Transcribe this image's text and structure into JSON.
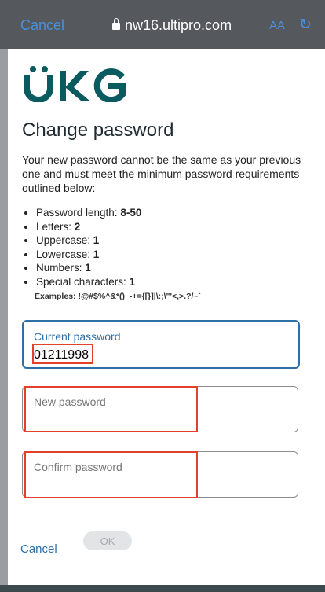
{
  "browser": {
    "cancel_label": "Cancel",
    "url": "nw16.ultipro.com",
    "text_size_label": "AA",
    "reload_icon": "↻"
  },
  "page": {
    "logo_text": "UKG",
    "title": "Change password",
    "intro": "Your new password cannot be the same as your previous one and must meet the minimum password requirements outlined below:",
    "requirements": [
      {
        "label": "Password length: ",
        "value": "8-50"
      },
      {
        "label": "Letters: ",
        "value": "2"
      },
      {
        "label": "Uppercase: ",
        "value": "1"
      },
      {
        "label": "Lowercase: ",
        "value": "1"
      },
      {
        "label": "Numbers: ",
        "value": "1"
      },
      {
        "label": "Special characters: ",
        "value": "1"
      }
    ],
    "examples": "Examples: !@#$%^&*()_-+={[}]|\\:;\\\"'<,>.?/~`",
    "fields": {
      "current": {
        "label": "Current password",
        "value": "01211998"
      },
      "new": {
        "label": "New password"
      },
      "confirm": {
        "label": "Confirm password"
      }
    },
    "cancel_label": "Cancel",
    "ok_label": "OK"
  },
  "colors": {
    "brand": "#0a5b5f",
    "link": "#2e6fa7",
    "highlight": "#e3412b"
  }
}
